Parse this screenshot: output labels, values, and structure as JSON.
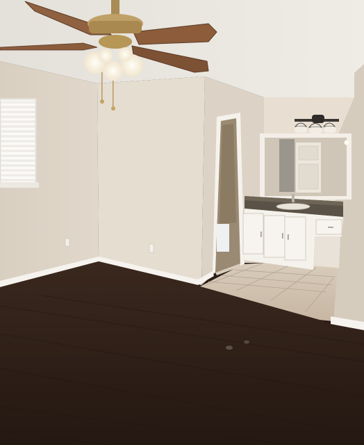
{
  "scene": {
    "type": "photo",
    "colors": {
      "ceiling": "#e9e5df",
      "wall_left": "#ddd4c6",
      "wall_center": "#e6ddd1",
      "wall_right": "#d9d0c3",
      "floor": "#2e1f18",
      "tile": "#cdbfae",
      "trim": "#f6f3ee",
      "fan_blade": "#8a5a3a",
      "fan_metal": "#b7995c",
      "counter": "#5a5246"
    }
  }
}
